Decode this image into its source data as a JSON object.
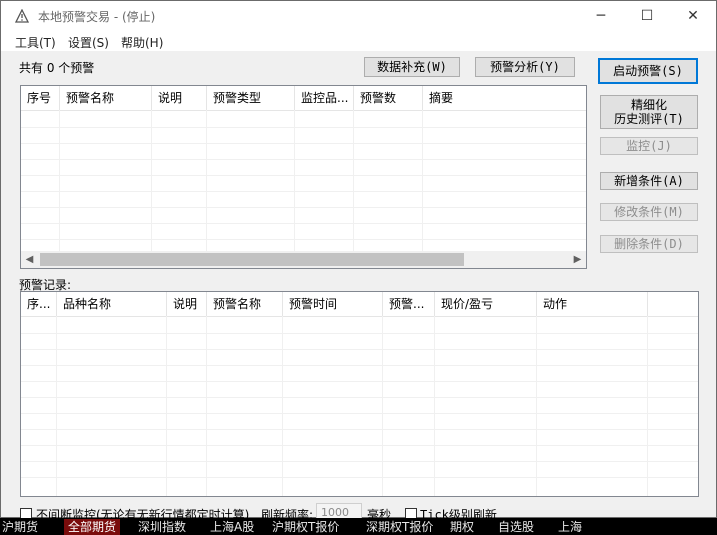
{
  "window": {
    "title": "本地预警交易 - (停止)",
    "minimize": "─",
    "maximize": "☐",
    "close": "✕"
  },
  "menu": {
    "items": [
      "工具(T)",
      "设置(S)",
      "帮助(H)"
    ]
  },
  "top": {
    "count_text": "共有 0 个预警",
    "data_fill_button": "数据补充(W)",
    "analysis_button": "预警分析(Y)"
  },
  "alerts_table": {
    "columns": [
      "序号",
      "预警名称",
      "说明",
      "预警类型",
      "监控品...",
      "预警数",
      "摘要"
    ]
  },
  "side_buttons": {
    "start": "启动预警(S)",
    "history_line1": "精细化",
    "history_line2": "历史测评(T)",
    "monitor": "监控(J)",
    "add": "新增条件(A)",
    "edit": "修改条件(M)",
    "delete": "删除条件(D)"
  },
  "records": {
    "label": "预警记录:",
    "columns": [
      "序...",
      "品种名称",
      "说明",
      "预警名称",
      "预警时间",
      "预警...",
      "现价/盈亏",
      "动作"
    ]
  },
  "bottom": {
    "continuous_label": "不间断监控(无论有无新行情都定时计算)",
    "refresh_label": "刷新频率:",
    "refresh_value": "1000",
    "ms_label": "毫秒",
    "tick_label": "Tick级别刷新"
  },
  "taskbar": {
    "items": [
      "沪期货",
      "全部期货",
      "深圳指数",
      "上海A股",
      "沪期权T报价",
      "深期权T报价",
      "期权",
      "自选股",
      "上海"
    ]
  }
}
